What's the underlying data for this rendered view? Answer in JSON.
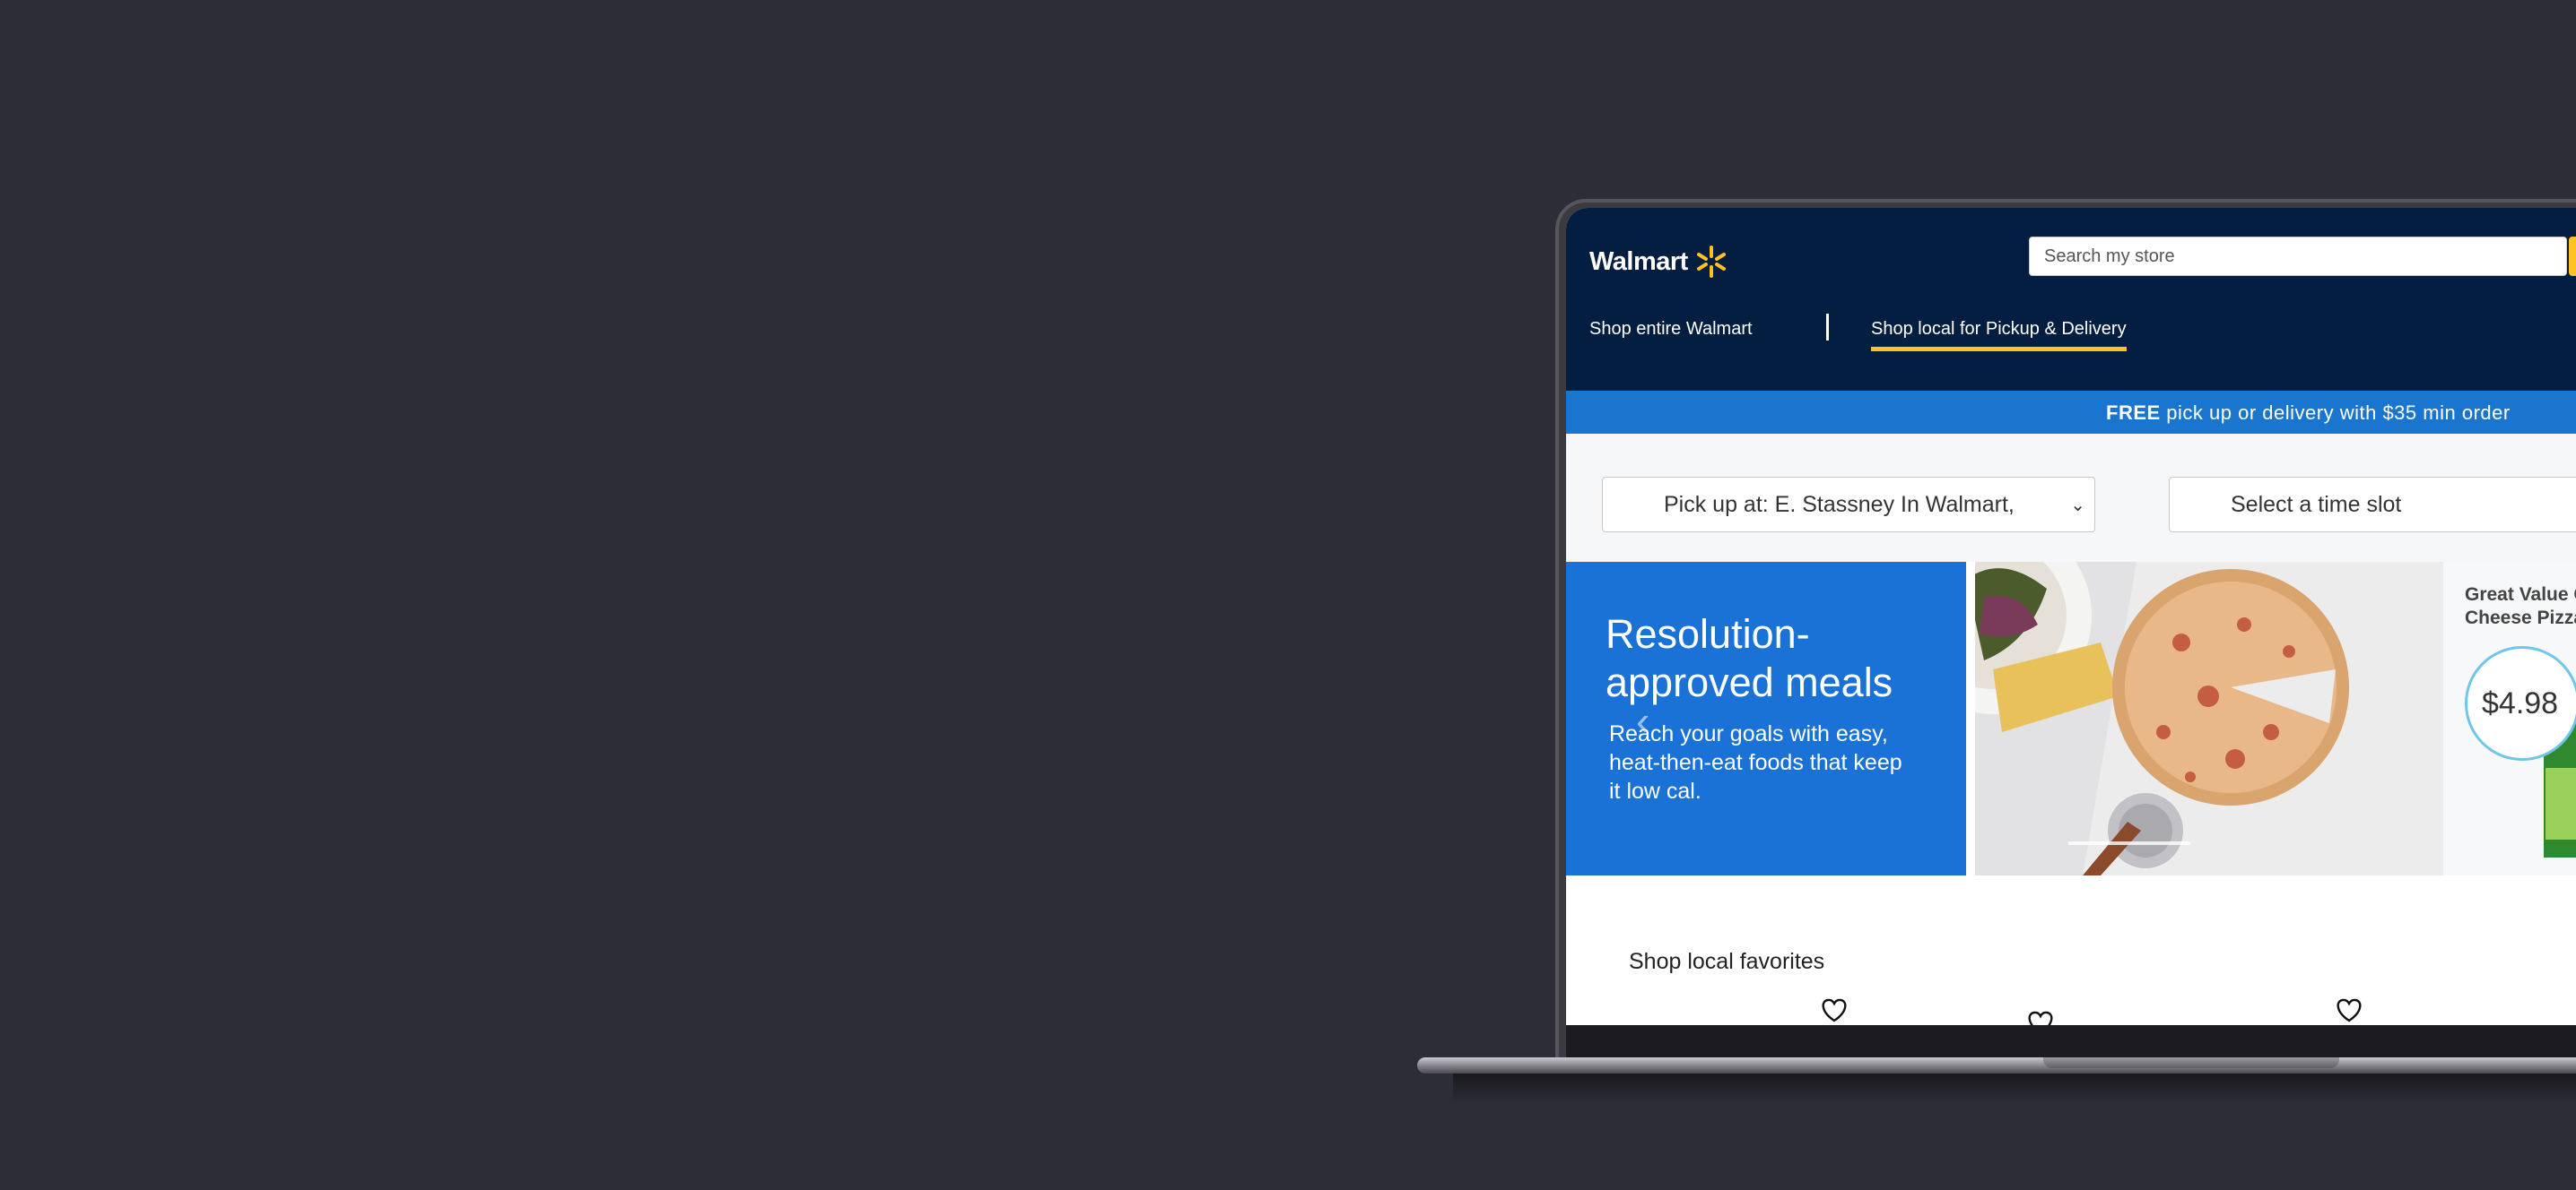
{
  "header": {
    "logo_text": "Walmart",
    "search_placeholder": "Search my store",
    "nav": {
      "shop_entire": "Shop entire Walmart",
      "shop_local": "Shop local for Pickup & Delivery"
    }
  },
  "promo": {
    "bold": "FREE",
    "text": " pick up or delivery with $35 min order"
  },
  "selectors": {
    "pickup_value": "Pick up at: E. Stassney In Walmart,",
    "timeslot_value": "Select a time slot"
  },
  "hero": {
    "title": "Resolution-approved meals",
    "subtitle": "Reach your goals with easy, heat-then-eat foods that keep it low cal.",
    "product_name_line1": "Great Value C",
    "product_name_line2": "Cheese Pizza",
    "price": "$4.98"
  },
  "favorites": {
    "title": "Shop local favorites"
  },
  "colors": {
    "background": "#2d2d37",
    "header_navy": "#041e42",
    "accent_yellow": "#ffc220",
    "promo_blue": "#1a75cf",
    "hero_blue": "#1a72d6"
  }
}
